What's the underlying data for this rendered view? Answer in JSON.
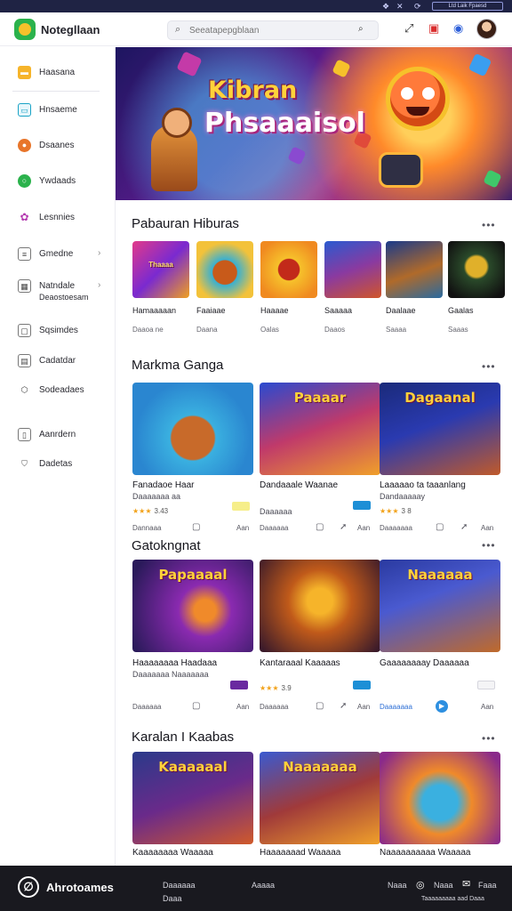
{
  "topbar": {
    "icons": [
      "share-icon",
      "close-x-icon",
      "sync-icon"
    ],
    "badge": "Ltd Laik Fpaesd"
  },
  "header": {
    "brand": "Notegllaan",
    "search_placeholder": "Seeatapepgblaan",
    "icons": [
      "expand-icon",
      "notification-icon",
      "globe-icon",
      "avatar"
    ]
  },
  "sidebar": {
    "items": [
      {
        "label": "Haasana",
        "icon": "folder-icon"
      },
      {
        "label": "Hnsaeme",
        "icon": "monitor-icon"
      },
      {
        "label": "Dsaanes",
        "icon": "circle-icon"
      },
      {
        "label": "Ywdaads",
        "icon": "check-circle-icon"
      },
      {
        "label": "Lesnnies",
        "icon": "flower-icon"
      },
      {
        "label": "Gmedne",
        "icon": "list-icon"
      },
      {
        "label": "Natndale",
        "label2": "Deaostoesam",
        "icon": "grid-icon"
      },
      {
        "label": "Sqsimdes",
        "icon": "square-icon"
      },
      {
        "label": "Cadatdar",
        "icon": "calendar-icon"
      },
      {
        "label": "Sodeadaes",
        "icon": "hexagon-icon"
      },
      {
        "label": "Aanrdern",
        "icon": "book-icon"
      },
      {
        "label": "Dadetas",
        "icon": "shield-icon"
      }
    ]
  },
  "hero": {
    "title_line1": "Kibran",
    "title_line2": "Phsaaaisol"
  },
  "section1": {
    "title": "Pabauran Hiburas",
    "more": "•••",
    "tiles": [
      {
        "art": "Thaaaa",
        "name": "Hamaaaaan",
        "sub": "Daaoa ne"
      },
      {
        "art": "",
        "name": "Faaiaae",
        "sub": "Daana"
      },
      {
        "art": "",
        "name": "Haaaae",
        "sub": "Oalas"
      },
      {
        "art": "",
        "name": "Saaaaa",
        "sub": "Daaos"
      },
      {
        "art": "",
        "name": "Daalaae",
        "sub": "Saaaa"
      },
      {
        "art": "",
        "name": "Gaalas",
        "sub": "Saaas"
      }
    ]
  },
  "section2": {
    "title": "Markma Ganga",
    "more": "•••",
    "cards": [
      {
        "art": "",
        "name": "Fanadaoe Haar",
        "sub": "Daaaaaaa aa",
        "rating": "3.43",
        "tag": "",
        "tag_style": "y",
        "actions": [
          "Dannaaa",
          "Aan"
        ]
      },
      {
        "art": "Paaaar",
        "name": "Dandaaale Waanae",
        "sub": "Daaaaaa",
        "rating": "",
        "tag": "",
        "tag_style": "b",
        "actions": [
          "Daaaaaa",
          "Aan"
        ]
      },
      {
        "art": "Dagaanal",
        "name": "Laaaaao ta taaanlang",
        "sub": "Dandaaaaay",
        "rating": "3 8",
        "tag": "",
        "tag_style": "",
        "actions": [
          "Daaaaaaa",
          "Aan"
        ]
      }
    ]
  },
  "section3": {
    "title": "Gatokngnat",
    "more": "•••",
    "cards": [
      {
        "art": "Papaaaal",
        "name": "Haaaaaaaa Haadaaa",
        "sub": "Daaaaaaa Naaaaaaa",
        "rating": "",
        "tag": "",
        "tag_style": "p",
        "actions": [
          "Daaaaaa",
          "Aan"
        ]
      },
      {
        "art": "",
        "name": "Kantaraaal Kaaaaas",
        "sub": "",
        "rating": "3.9",
        "tag": "",
        "tag_style": "b",
        "actions": [
          "Daaaaaa",
          "Aan"
        ]
      },
      {
        "art": "Naaaaaa",
        "name": "Gaaaaaaaay Daaaaaa",
        "sub": "",
        "rating": "",
        "tag": "",
        "tag_style": "g",
        "actions": [
          "Daaaaaaa",
          "Aan"
        ]
      }
    ]
  },
  "section4": {
    "title": "Karalan I Kaabas",
    "more": "•••",
    "cards": [
      {
        "art": "Kaaaaaal",
        "name": "Kaaaaaaaa Waaaaa"
      },
      {
        "art": "Naaaaaaa",
        "name": "Haaaaaaad Waaaaa"
      },
      {
        "art": "",
        "name": "Naaaaaaaaaa Waaaaa"
      }
    ]
  },
  "footer": {
    "brand": "Ahrotoames",
    "links": [
      "Daaaaaa",
      "Daaa"
    ],
    "link2": "Aaaaa",
    "right": [
      "Naaa",
      "Naaa",
      "Faaa"
    ],
    "bottom": "Taaaaaaaaa aad Daaa"
  }
}
